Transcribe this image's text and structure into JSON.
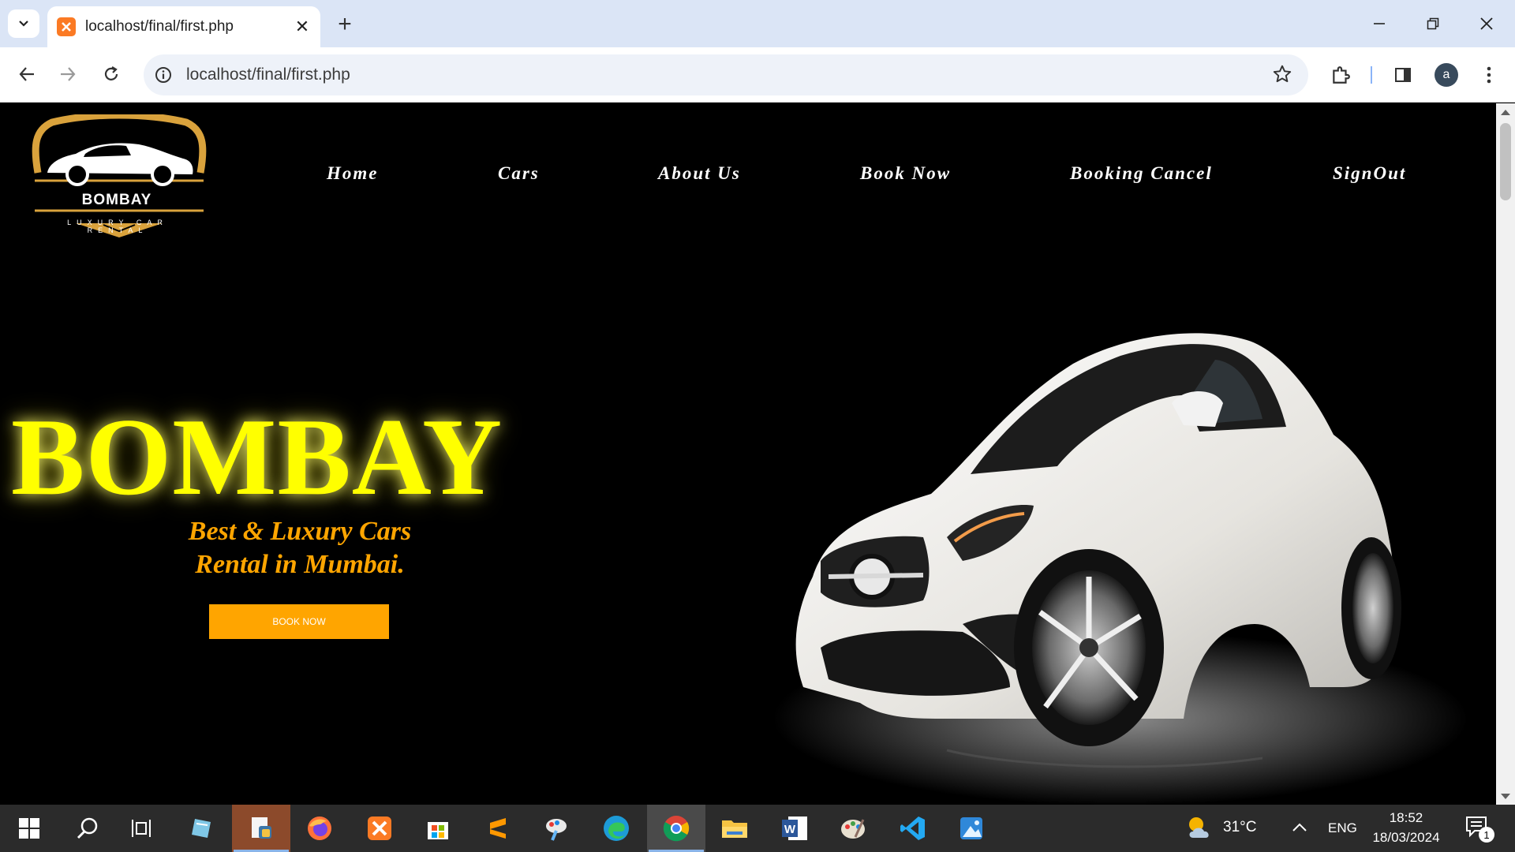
{
  "browser": {
    "tab_title": "localhost/final/first.php",
    "url": "localhost/final/first.php",
    "profile_initial": "a"
  },
  "site": {
    "logo_name": "BOMBAY",
    "logo_tagline": "LUXURY CAR RENTAL",
    "nav": [
      "Home",
      "Cars",
      "About Us",
      "Book Now",
      "Booking Cancel",
      "SignOut"
    ],
    "hero_title": "BOMBAY",
    "hero_subtitle_line1": "Best & Luxury Cars",
    "hero_subtitle_line2": "Rental in Mumbai.",
    "cta_label": "BOOK NOW",
    "colors": {
      "title": "#ffff00",
      "accent": "#ffa500",
      "background": "#000000"
    }
  },
  "taskbar": {
    "weather": "31°C",
    "language": "ENG",
    "time": "18:52",
    "date": "18/03/2024",
    "notifications": "1",
    "apps": [
      "start",
      "search",
      "task-view",
      "notepad",
      "python-idle",
      "firefox",
      "xampp",
      "microsoft-store",
      "sublime-text",
      "paint-app",
      "edge",
      "chrome",
      "file-explorer",
      "word",
      "paint",
      "vscode",
      "photos"
    ]
  }
}
